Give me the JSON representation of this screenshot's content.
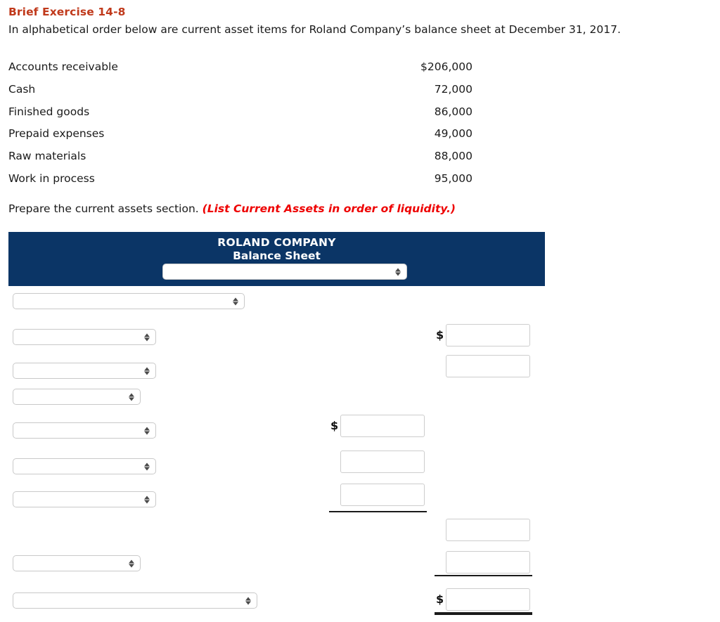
{
  "exercise": {
    "title": "Brief Exercise 14-8",
    "intro": "In alphabetical order below are current asset items for Roland Company’s balance sheet at December 31, 2017."
  },
  "given_items": [
    {
      "label": "Accounts receivable",
      "amount": "$206,000"
    },
    {
      "label": "Cash",
      "amount": "72,000"
    },
    {
      "label": "Finished goods",
      "amount": "86,000"
    },
    {
      "label": "Prepaid expenses",
      "amount": "49,000"
    },
    {
      "label": "Raw materials",
      "amount": "88,000"
    },
    {
      "label": "Work in process",
      "amount": "95,000"
    }
  ],
  "instruction": {
    "prefix": "Prepare the current assets section.",
    "emphasis": "(List Current Assets in order of liquidity.)"
  },
  "statement": {
    "company_name": "ROLAND COMPANY",
    "statement_title": "Balance Sheet",
    "header_select_value": ""
  },
  "form": {
    "selects": [
      {
        "name": "section-heading-select",
        "value": ""
      },
      {
        "name": "line-item-1-select",
        "value": ""
      },
      {
        "name": "line-item-2-select",
        "value": ""
      },
      {
        "name": "line-item-3-select",
        "value": ""
      },
      {
        "name": "line-item-4-select",
        "value": ""
      },
      {
        "name": "line-item-5-select",
        "value": ""
      },
      {
        "name": "line-item-6-select",
        "value": ""
      },
      {
        "name": "subtotal-label-select",
        "value": ""
      },
      {
        "name": "total-label-select",
        "value": ""
      }
    ],
    "amount_inputs": [
      {
        "name": "amount-right-1",
        "value": "",
        "dollar": "$"
      },
      {
        "name": "amount-right-2",
        "value": "",
        "dollar": ""
      },
      {
        "name": "amount-mid-1",
        "value": "",
        "dollar": "$"
      },
      {
        "name": "amount-mid-2",
        "value": "",
        "dollar": ""
      },
      {
        "name": "amount-mid-3",
        "value": "",
        "dollar": ""
      },
      {
        "name": "amount-right-3",
        "value": "",
        "dollar": ""
      },
      {
        "name": "amount-right-4",
        "value": "",
        "dollar": ""
      },
      {
        "name": "amount-total",
        "value": "",
        "dollar": "$"
      }
    ],
    "dollar_sign": "$"
  },
  "colors": {
    "title_red": "#c0391b",
    "emphasis_red": "#ee0000",
    "banner_navy": "#0b3566",
    "input_border": "#cdcdcd"
  }
}
